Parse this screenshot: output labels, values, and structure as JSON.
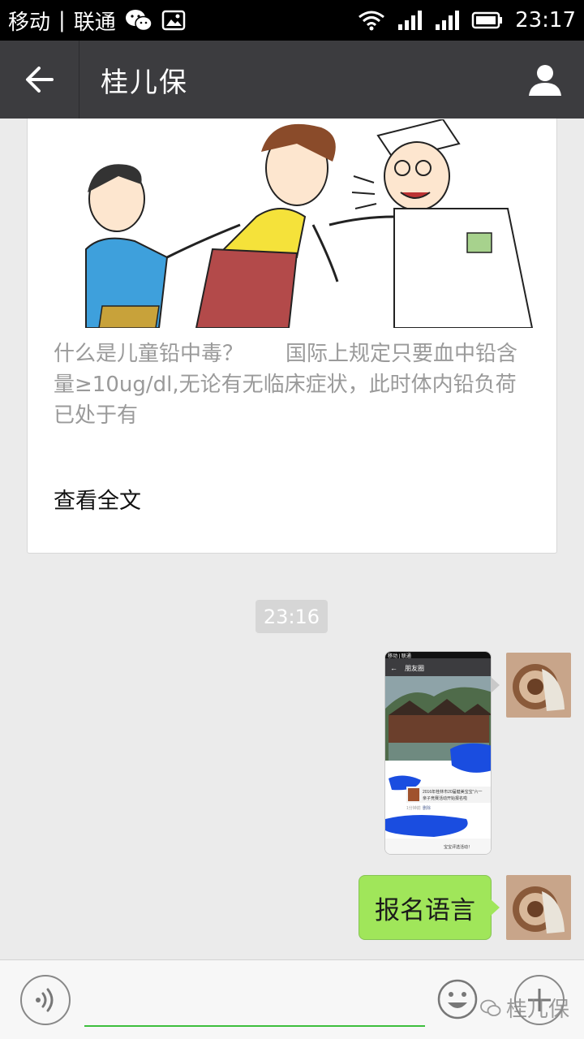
{
  "status_bar": {
    "carrier_1": "移动",
    "separator": "|",
    "carrier_2": "联通",
    "time": "23:17",
    "icons": [
      "wechat-icon",
      "gallery-icon",
      "wifi-icon",
      "signal-icon",
      "signal-icon",
      "battery-icon"
    ]
  },
  "header": {
    "title": "桂儿保",
    "back_icon": "arrow-left-icon",
    "profile_icon": "person-icon"
  },
  "article": {
    "summary": "什么是儿童铅中毒？　　国际上规定只要血中铅含量≥10ug/dl,无论有无临床症状，此时体内铅负荷已处于有",
    "read_more": "查看全文"
  },
  "messages": {
    "timestamp": "23:16",
    "text_message": "报名语言"
  },
  "shared_screenshot": {
    "status_left": "移动 | 联通",
    "title": "朋友圈",
    "post_text_line1": "2016年桂林市20届健美宝宝\"六一",
    "post_text_line2": "亲子竞赛活动开始报名啦",
    "post_meta": "1分钟前",
    "post_action": "删除",
    "bottom_text": "宝宝评选活动！"
  },
  "input_bar": {
    "placeholder": "",
    "watermark": "桂儿保"
  },
  "colors": {
    "status_bar": "#000000",
    "title_bar": "#3c3c3f",
    "chat_background": "#ebebeb",
    "bubble_green": "#a0e65a",
    "input_underline": "#3dbf3d"
  }
}
